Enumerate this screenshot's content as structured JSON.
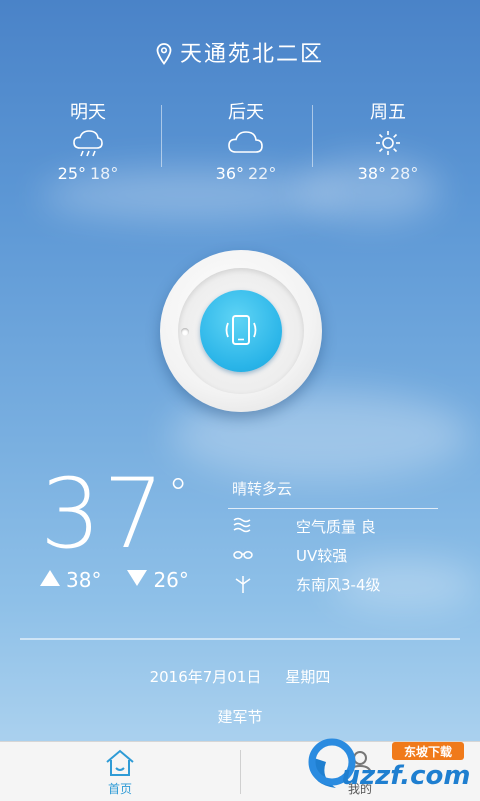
{
  "location": {
    "name": "天通苑北二区",
    "icon": "location-pin-icon"
  },
  "forecast": [
    {
      "day": "明天",
      "icon": "rain-cloud-icon",
      "high": "25°",
      "low": "18°"
    },
    {
      "day": "后天",
      "icon": "cloud-icon",
      "high": "36°",
      "low": "22°"
    },
    {
      "day": "周五",
      "icon": "sun-icon",
      "high": "38°",
      "low": "28°"
    }
  ],
  "dial": {
    "icon": "phone-vibrate-icon"
  },
  "current": {
    "temp": "37",
    "deg": "°",
    "high": "38°",
    "low": "26°",
    "condition": "晴转多云"
  },
  "details": [
    {
      "icon": "air-quality-icon",
      "text": "空气质量 良"
    },
    {
      "icon": "sunglasses-icon",
      "text": "UV较强"
    },
    {
      "icon": "windmill-icon",
      "text": "东南风3-4级"
    }
  ],
  "date": {
    "date": "2016年7月01日",
    "weekday": "星期四"
  },
  "holiday": "建军节",
  "tabs": [
    {
      "label": "首页",
      "icon": "home-icon",
      "active": true
    },
    {
      "label": "我的",
      "icon": "profile-icon",
      "active": false
    }
  ],
  "watermark": {
    "brand": "uzzf.com",
    "tagline": "东坡下载"
  },
  "colors": {
    "accent": "#2e9bd6",
    "dial_blue": "#29b4e8"
  }
}
